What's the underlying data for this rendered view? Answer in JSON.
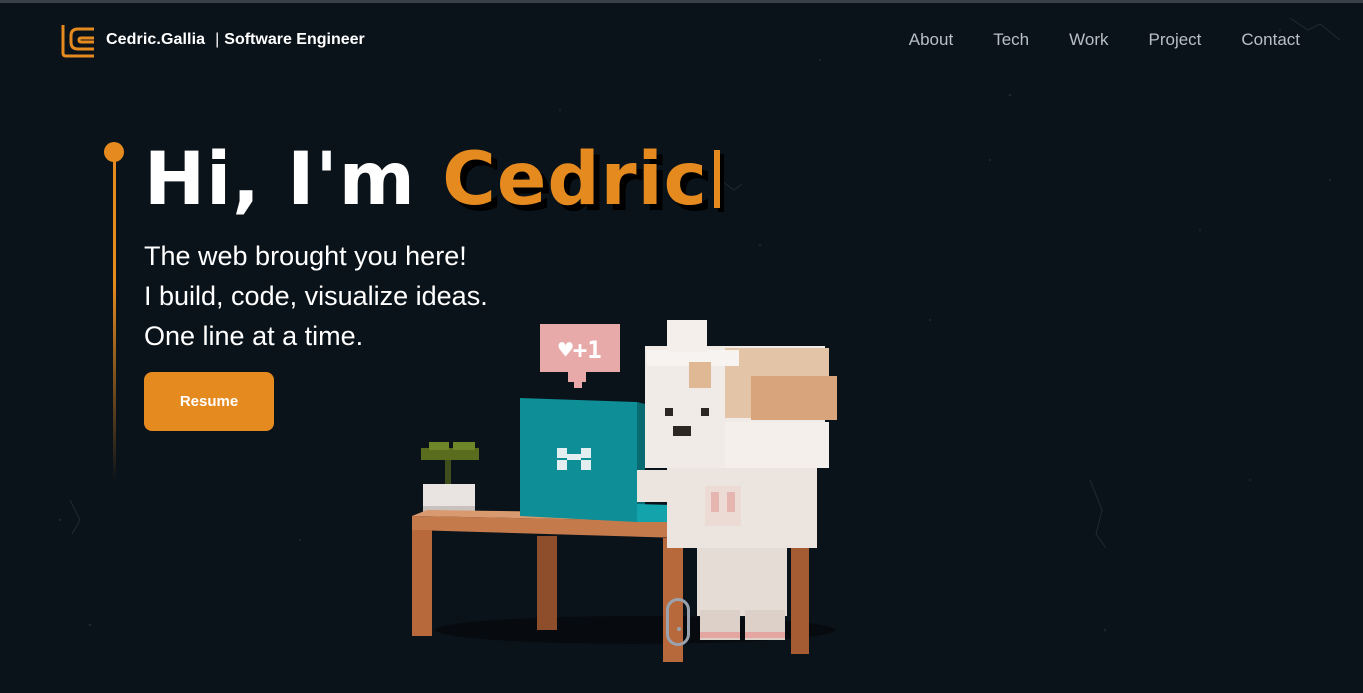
{
  "header": {
    "brand_name": "Cedric.Gallia",
    "brand_separator": "|",
    "brand_role": "Software Engineer",
    "nav": [
      "About",
      "Tech",
      "Work",
      "Project",
      "Contact"
    ]
  },
  "hero": {
    "greeting": "Hi, I'm",
    "name": "Cedric",
    "lines": [
      "The web brought you here!",
      "I build, code, visualize ideas.",
      "One line at a time."
    ],
    "resume_label": "Resume"
  },
  "illustration": {
    "bubble_text": "♥+1"
  },
  "colors": {
    "accent": "#e58a1f",
    "background": "#0b131a",
    "nav_text": "#b9bfc6",
    "laptop": "#0e8e96",
    "desk": "#c57a4c"
  },
  "icons": {
    "logo": "logo-icon",
    "scroll": "mouse-scroll-icon"
  }
}
